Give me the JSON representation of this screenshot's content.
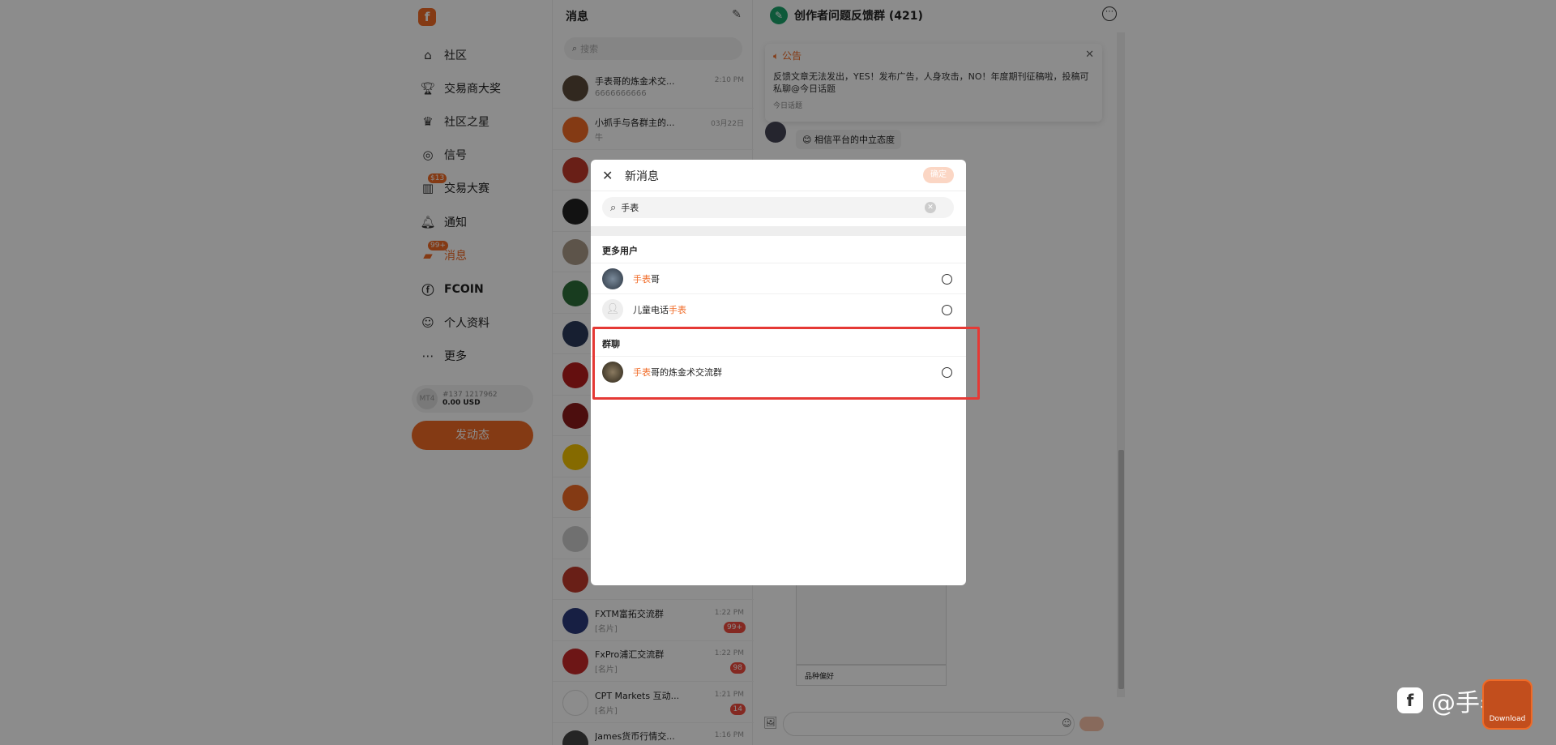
{
  "nav": {
    "items": [
      {
        "label": "社区",
        "icon": "home-icon"
      },
      {
        "label": "交易商大奖",
        "icon": "trophy-icon"
      },
      {
        "label": "社区之星",
        "icon": "crown-icon"
      },
      {
        "label": "信号",
        "icon": "signal-icon"
      },
      {
        "label": "交易大赛",
        "icon": "chart-icon",
        "badge": "$13"
      },
      {
        "label": "通知",
        "icon": "bell-icon"
      },
      {
        "label": "消息",
        "icon": "message-icon",
        "badge": "99+",
        "active": true
      },
      {
        "label": "FCOIN",
        "icon": "coin-icon"
      },
      {
        "label": "个人资料",
        "icon": "profile-icon"
      },
      {
        "label": "更多",
        "icon": "more-icon"
      }
    ],
    "mt4": {
      "avatar": "MT4",
      "account": "#137  1217962",
      "balance": "0.00 USD"
    },
    "post_button": "发动态"
  },
  "messages": {
    "title": "消息",
    "search_placeholder": "搜索",
    "chats": [
      {
        "name": "手表哥的炼金术交...",
        "sub": "6666666666",
        "time": "2:10 PM"
      },
      {
        "name": "小抓手与各群主的...",
        "sub": "牛",
        "time": "03月22日"
      },
      {
        "name": "",
        "sub": "",
        "time": ""
      },
      {
        "name": "",
        "sub": "",
        "time": ""
      },
      {
        "name": "",
        "sub": "",
        "time": ""
      },
      {
        "name": "",
        "sub": "",
        "time": ""
      },
      {
        "name": "",
        "sub": "",
        "time": ""
      },
      {
        "name": "",
        "sub": "",
        "time": ""
      },
      {
        "name": "",
        "sub": "",
        "time": ""
      },
      {
        "name": "",
        "sub": "",
        "time": ""
      },
      {
        "name": "",
        "sub": "",
        "time": ""
      },
      {
        "name": "",
        "sub": "",
        "time": ""
      },
      {
        "name": "",
        "sub": "",
        "time": ""
      },
      {
        "name": "FXTM富拓交流群",
        "sub": "[名片]",
        "time": "1:22 PM",
        "count": "99+"
      },
      {
        "name": "FxPro浦汇交流群",
        "sub": "[名片]",
        "time": "1:22 PM",
        "count": "98"
      },
      {
        "name": "CPT Markets 互动...",
        "sub": "[名片]",
        "time": "1:21 PM",
        "count": "14"
      },
      {
        "name": "James货币行情交...",
        "sub": "",
        "time": "1:16 PM"
      }
    ]
  },
  "chat": {
    "title": "创作者问题反馈群 (421)",
    "notice": {
      "heading": "公告",
      "body": "反馈文章无法发出，YES！发布广告，人身攻击，NO！年度期刊征稿啦，投稿可私聊@今日话题",
      "footer": "今日话题"
    },
    "msg1": "相信平台的中立态度",
    "bottom_label": "品种偏好"
  },
  "modal": {
    "title": "新消息",
    "confirm": "确定",
    "search_value": "手表",
    "section_users": "更多用户",
    "users": [
      {
        "pre": "",
        "hl": "手表",
        "post": "哥"
      },
      {
        "pre": "儿童电话",
        "hl": "手表",
        "post": ""
      }
    ],
    "section_groups": "群聊",
    "groups": [
      {
        "pre": "",
        "hl": "手表",
        "post": "哥的炼金术交流群"
      }
    ]
  },
  "watermark": {
    "text": "@手表哥",
    "logo": "f",
    "download": "Download"
  },
  "colors": {
    "accent": "#f06a26",
    "highlight": "#e53935"
  }
}
